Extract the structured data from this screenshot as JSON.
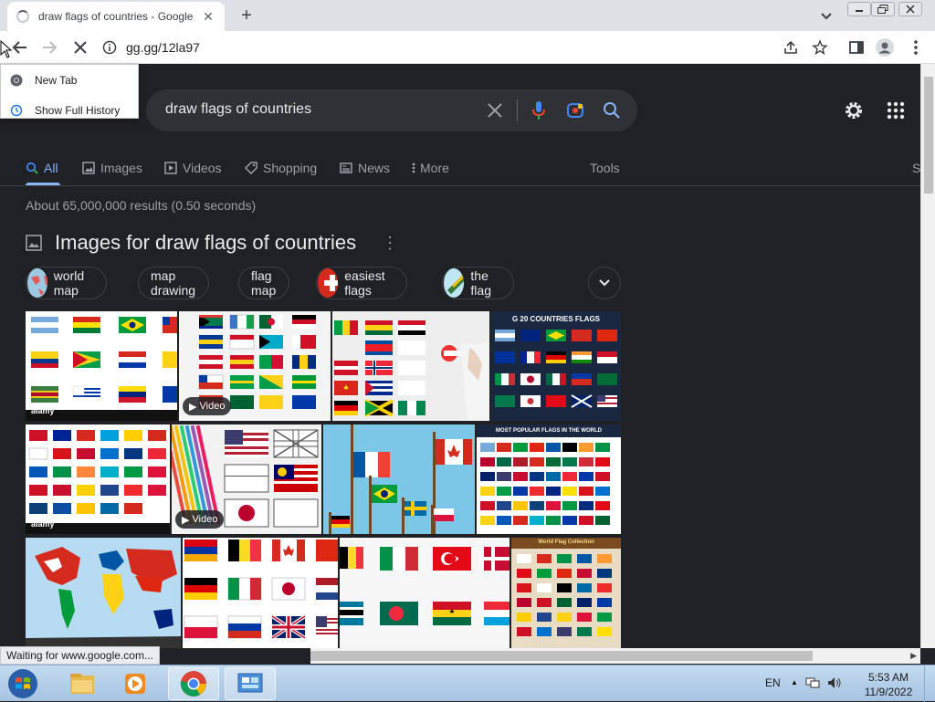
{
  "browser": {
    "tab_title": "draw flags of countries - Google",
    "url": "gg.gg/12la97",
    "history_menu": [
      {
        "label": "New Tab"
      },
      {
        "label": "Show Full History"
      }
    ],
    "status_text": "Waiting for www.google.com..."
  },
  "search": {
    "query": "draw flags of countries",
    "tabs": [
      {
        "label": "All",
        "icon": "search-icon"
      },
      {
        "label": "Images",
        "icon": "image-icon"
      },
      {
        "label": "Videos",
        "icon": "play-icon"
      },
      {
        "label": "Shopping",
        "icon": "tag-icon"
      },
      {
        "label": "News",
        "icon": "news-icon"
      },
      {
        "label": "More",
        "icon": "kebab-icon"
      }
    ],
    "tools_label": "Tools",
    "partial_right_label": "S",
    "result_stats": "About 65,000,000 results (0.50 seconds)",
    "images_heading": "Images for draw flags of countries",
    "chips": [
      {
        "label": "world map"
      },
      {
        "label": "map drawing"
      },
      {
        "label": "flag map"
      },
      {
        "label": "easiest flags"
      },
      {
        "label": "the flag"
      }
    ],
    "thumbs": {
      "t1_stamp": "alamy",
      "t2_badge": "Video",
      "t4_caption": "G 20 COUNTRIES FLAGS",
      "t5_stamp": "alamy",
      "t6_badge": "Video",
      "t8_caption": "MOST POPULAR FLAGS IN THE WORLD",
      "t12_caption": "World Flag Collection"
    }
  },
  "taskbar": {
    "language": "EN",
    "time": "5:53 AM",
    "date": "11/9/2022"
  },
  "colors": {
    "page_bg": "#202124",
    "accent": "#8ab4f8",
    "text_primary": "#e8eaed",
    "text_secondary": "#9aa0a6"
  }
}
